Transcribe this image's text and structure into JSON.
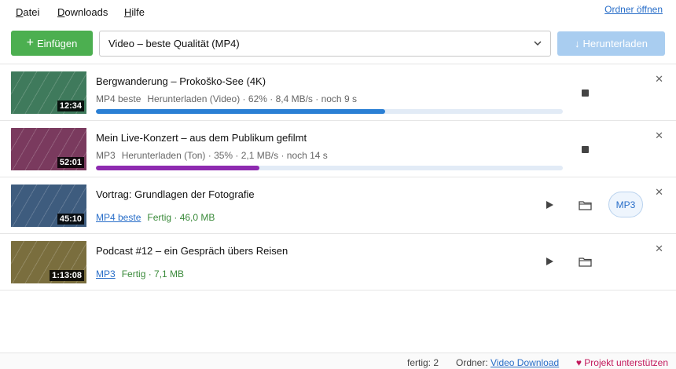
{
  "menu": {
    "items": [
      "Datei",
      "Downloads",
      "Hilfe"
    ],
    "open_folder_link": "Ordner öffnen"
  },
  "toolbar": {
    "add_label": "Einfügen",
    "add_icon": "+",
    "quality_value": "Video – beste Qualität (MP4)",
    "download_label": "Herunterladen",
    "download_icon": "↓"
  },
  "downloads": [
    {
      "title": "Bergwanderung – Prokoško-See (4K)",
      "duration": "12:34",
      "format": "MP4 beste",
      "status": "Herunterladen (Video) · 62% · 8,4 MB/s · noch 9 s",
      "progress": 0.62,
      "state": "downloading",
      "thumb_color": "#3f7a5c",
      "progress_color": "#2a7fd4"
    },
    {
      "title": "Mein Live-Konzert – aus dem Publikum gefilmt",
      "duration": "52:01",
      "format": "MP3",
      "status": "Herunterladen (Ton) · 35% · 2,1 MB/s · noch 14 s",
      "progress": 0.35,
      "state": "downloading",
      "thumb_color": "#7a3a5e",
      "progress_color": "#8e2ab0"
    },
    {
      "title": "Vortrag: Grundlagen der Fotografie",
      "duration": "45:10",
      "format": "MP4 beste",
      "status": "Fertig · 46,0 MB",
      "state": "done",
      "thumb_color": "#3e5c7e",
      "convert_label": "MP3"
    },
    {
      "title": "Podcast #12 – ein Gespräch übers Reisen",
      "duration": "1:13:08",
      "format": "MP3",
      "status": "Fertig · 7,1 MB",
      "state": "done",
      "thumb_color": "#7a6e3e"
    }
  ],
  "statusbar": {
    "done_count": "fertig: 2",
    "folder_label": "Ordner:",
    "folder_link": "Video Download",
    "support": "♥ Projekt unterstützen"
  },
  "colors": {
    "accent_green": "#4caf50",
    "accent_blue": "#2a6fc9",
    "done_green": "#3a8a3a",
    "support_pink": "#c2185b"
  }
}
